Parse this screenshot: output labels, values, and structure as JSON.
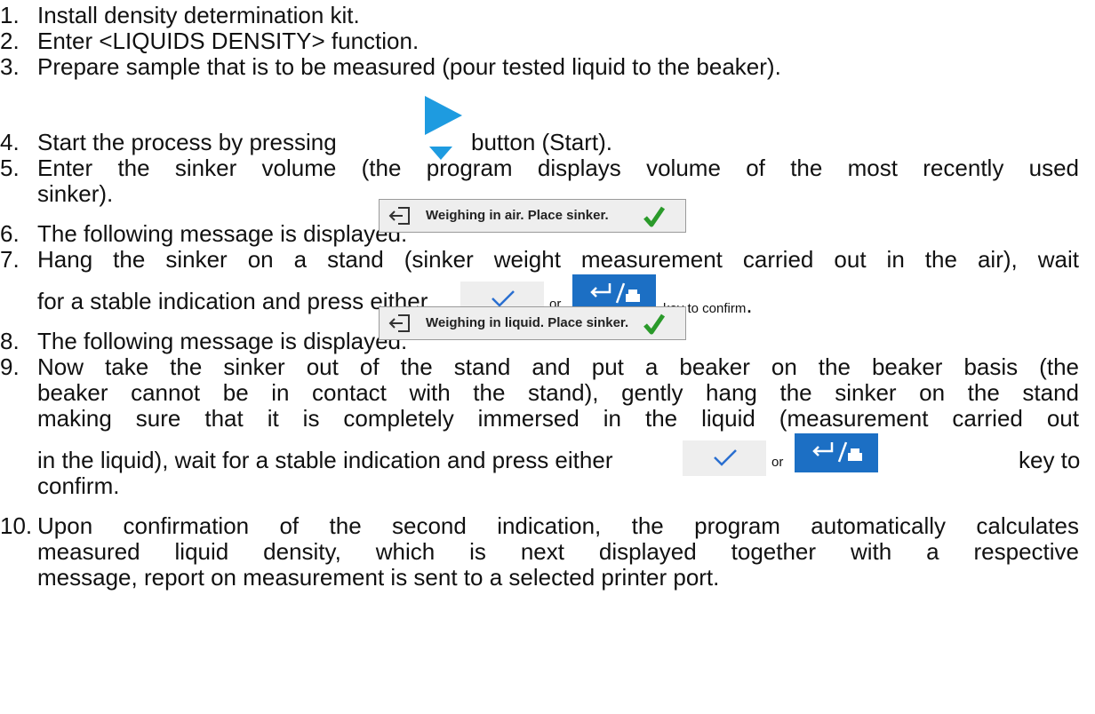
{
  "steps": [
    {
      "num": "1.",
      "text": "Install density determination kit."
    },
    {
      "num": "2.",
      "text": "Enter <LIQUIDS DENSITY> function."
    },
    {
      "num": "3.",
      "text": "Prepare sample that is to be measured (pour tested liquid to the beaker)."
    },
    {
      "num": "4.",
      "text_before": "Start the process by pressing",
      "text_after": "button (Start)."
    },
    {
      "num": "5.",
      "line1": "Enter the sinker volume (the program displays volume of the most recently used",
      "line2": "sinker)."
    },
    {
      "num": "6.",
      "text": "The following message is displayed:"
    },
    {
      "num": "7.",
      "line1": "Hang the sinker on a stand (sinker weight measurement carried out in the air), wait",
      "line2_before": "for a stable indication and press either",
      "or": "or",
      "line2_after": "key to confirm",
      "period": "."
    },
    {
      "num": "8.",
      "text": "The following message is displayed:"
    },
    {
      "num": "9.",
      "line1": "Now take the sinker out of the stand and put a beaker on the beaker basis (the",
      "line2": "beaker cannot be in contact with the stand), gently hang the sinker on the stand",
      "line3": "making sure that it is completely immersed in the liquid (measurement carried out",
      "line4_before": "in the liquid), wait for a stable indication and press either",
      "or": "or",
      "line4_after": "key to",
      "line5": "confirm."
    },
    {
      "num": "10.",
      "line1": "Upon confirmation of the second indication, the program automatically calculates",
      "line2": "measured liquid density, which is next displayed together with a respective",
      "line3": "message, report on measurement is sent to a selected printer port."
    }
  ],
  "messages": {
    "air": "Weighing in air. Place sinker.",
    "liquid": "Weighing in liquid. Place sinker."
  },
  "icons": {
    "start": "start-play-icon",
    "exit": "exit-icon",
    "check": "checkmark-icon",
    "key_confirm": "check-key-icon",
    "key_enter_print": "enter-print-key-icon"
  },
  "colors": {
    "start_blue": "#1e9be0",
    "check_green": "#2a9a2a",
    "enter_key_blue": "#1c6fc4",
    "box_grey": "#eeeeee"
  }
}
